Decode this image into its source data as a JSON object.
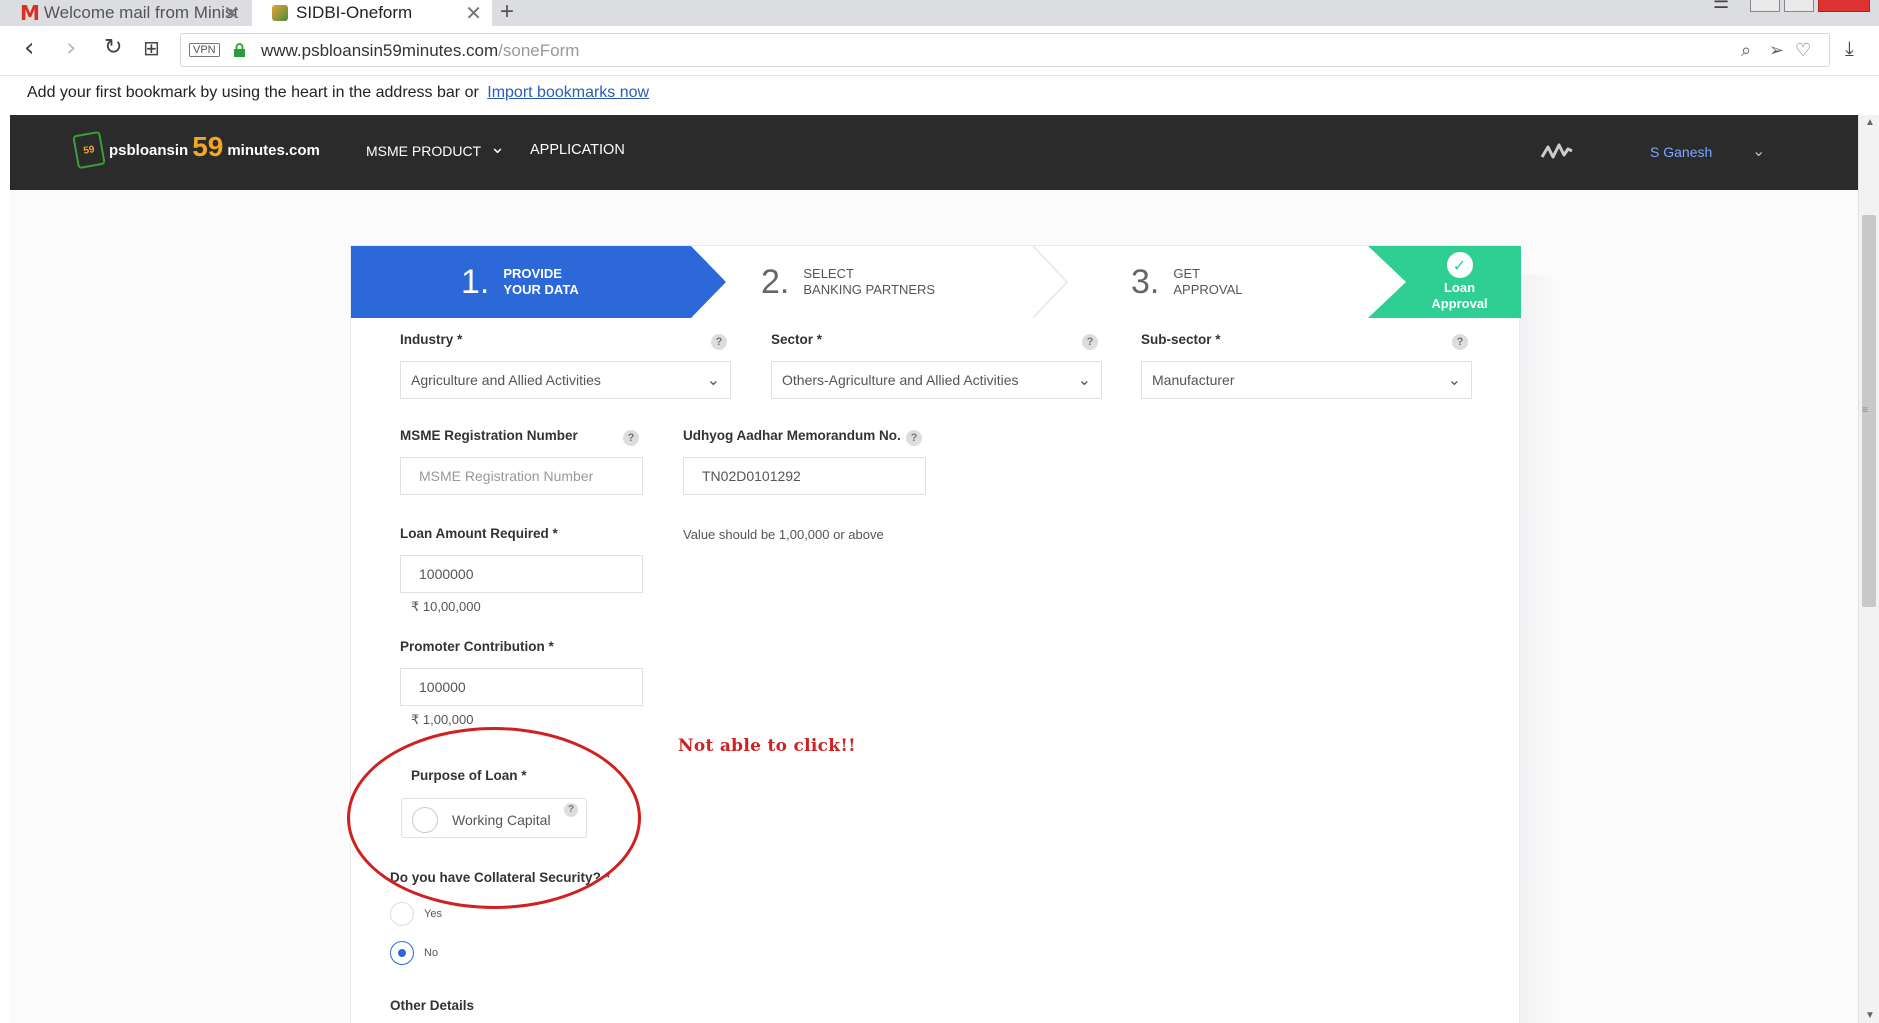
{
  "browser": {
    "tabs": [
      {
        "title": "Welcome mail from Minist",
        "icon": "gmail-icon"
      },
      {
        "title": "SIDBI-Oneform",
        "icon": "site-favicon"
      }
    ],
    "new_tab": "+",
    "vpn_label": "VPN",
    "url_host": "www.psbloansin59minutes.com",
    "url_path": "/soneForm",
    "bookmark_bar": {
      "message": "Add your first bookmark by using the heart in the address bar or",
      "link": "Import bookmarks now"
    }
  },
  "site": {
    "logo": {
      "prefix": "psbloansin",
      "number": "59",
      "suffix": "minutes.com",
      "badge": "59"
    },
    "nav": {
      "msme_product": "MSME PRODUCT",
      "application": "APPLICATION"
    },
    "user": "S Ganesh",
    "colors": {
      "header_bg": "#2b2b2b",
      "primary": "#2c68d8",
      "success": "#2fcf94",
      "annotation": "#d02020"
    }
  },
  "stepper": {
    "step1": {
      "num": "1.",
      "line1": "PROVIDE",
      "line2": "YOUR DATA"
    },
    "step2": {
      "num": "2.",
      "line1": "SELECT",
      "line2": "BANKING PARTNERS"
    },
    "step3": {
      "num": "3.",
      "line1": "GET",
      "line2": "APPROVAL"
    },
    "step4": {
      "line1": "Loan",
      "line2": "Approval"
    }
  },
  "form": {
    "industry": {
      "label": "Industry *",
      "value": "Agriculture and Allied Activities"
    },
    "sector": {
      "label": "Sector *",
      "value": "Others-Agriculture and Allied Activities"
    },
    "subsector": {
      "label": "Sub-sector *",
      "value": "Manufacturer"
    },
    "msme_reg": {
      "label": "MSME Registration Number",
      "placeholder": "MSME Registration Number"
    },
    "udhyog": {
      "label": "Udhyog Aadhar Memorandum No.",
      "value": "TN02D0101292"
    },
    "loan_amount": {
      "label": "Loan Amount Required *",
      "value": "1000000",
      "formatted": "₹ 10,00,000",
      "hint": "Value should be 1,00,000 or above"
    },
    "promoter": {
      "label": "Promoter Contribution *",
      "value": "100000",
      "formatted": "₹ 1,00,000"
    },
    "purpose": {
      "label": "Purpose of Loan *",
      "option": "Working Capital"
    },
    "collateral": {
      "label": "Do you have Collateral Security? *",
      "yes": "Yes",
      "no": "No",
      "selected": "No"
    },
    "other_details": "Other Details",
    "help": "?"
  },
  "annotation": {
    "text": "Not able to click!!"
  }
}
